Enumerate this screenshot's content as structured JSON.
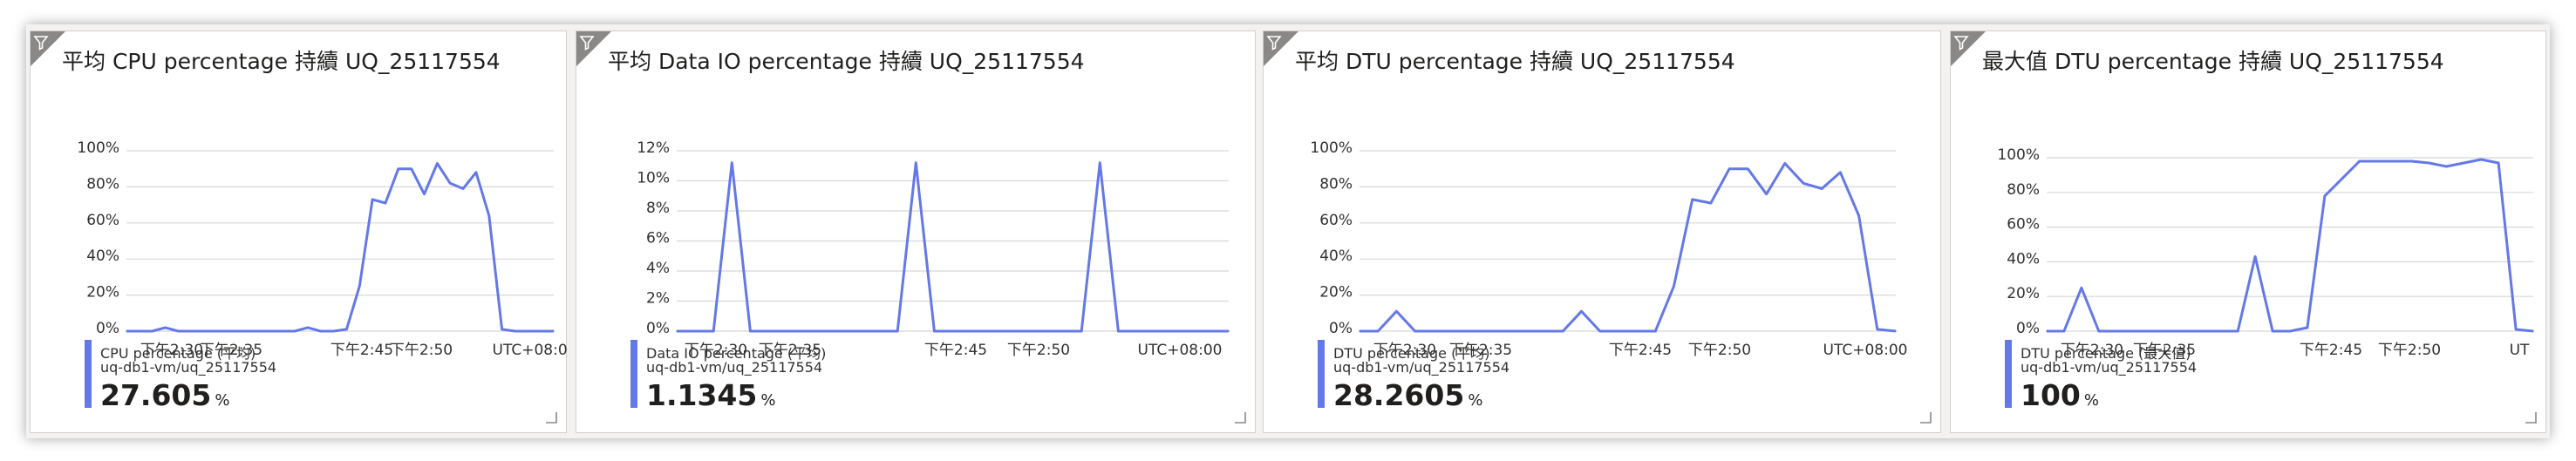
{
  "dashboard": {
    "tiles": [
      {
        "title": "平均 CPU percentage 持續 UQ_25117554",
        "metric_name": "CPU percentage (平均)",
        "resource": "uq-db1-vm/uq_25117554",
        "value": "27.605",
        "unit": "%"
      },
      {
        "title": "平均 Data IO percentage 持續 UQ_25117554",
        "metric_name": "Data IO percentage (平均)",
        "resource": "uq-db1-vm/uq_25117554",
        "value": "1.1345",
        "unit": "%"
      },
      {
        "title": "平均 DTU percentage 持續 UQ_25117554",
        "metric_name": "DTU percentage (平均)",
        "resource": "uq-db1-vm/uq_25117554",
        "value": "28.2605",
        "unit": "%"
      },
      {
        "title": "最大值 DTU percentage 持續 UQ_25117554",
        "metric_name": "DTU percentage (最大值)",
        "resource": "uq-db1-vm/uq_25117554",
        "value": "100",
        "unit": "%"
      }
    ]
  },
  "colors": {
    "line": "#6478e8",
    "grid": "#d7d7d7",
    "axis_text": "#323130",
    "accent": "#6478e8"
  },
  "icons": {
    "filter": "filter-icon",
    "resize": "resize-handle-icon"
  },
  "chart_data": [
    {
      "type": "line",
      "title": "平均 CPU percentage 持續 UQ_25117554",
      "xlabel": "",
      "ylabel": "",
      "ylim": [
        0,
        100
      ],
      "yticks": [
        "0%",
        "20%",
        "40%",
        "60%",
        "80%",
        "100%"
      ],
      "xticks": [
        "下午2:30",
        "下午2:35",
        "下午2:45",
        "下午2:50"
      ],
      "timezone_label": "UTC+08:00",
      "series": [
        {
          "name": "CPU percentage (平均)",
          "x": [
            "14:24",
            "14:25",
            "14:26",
            "14:27",
            "14:28",
            "14:29",
            "14:30",
            "14:31",
            "14:32",
            "14:33",
            "14:34",
            "14:35",
            "14:36",
            "14:37",
            "14:38",
            "14:39",
            "14:40",
            "14:41",
            "14:42",
            "14:43",
            "14:44",
            "14:45",
            "14:46",
            "14:47",
            "14:48",
            "14:49",
            "14:50",
            "14:51",
            "14:52",
            "14:53",
            "14:54",
            "14:55",
            "14:56",
            "14:57"
          ],
          "values": [
            0,
            0,
            0,
            2,
            0,
            0,
            0,
            0,
            0,
            0,
            0,
            0,
            0,
            0,
            2,
            0,
            0,
            1,
            25,
            73,
            71,
            90,
            90,
            76,
            93,
            82,
            79,
            88,
            64,
            1,
            0,
            0,
            0,
            0
          ]
        }
      ]
    },
    {
      "type": "line",
      "title": "平均 Data IO percentage 持續 UQ_25117554",
      "xlabel": "",
      "ylabel": "",
      "ylim": [
        0,
        12
      ],
      "yticks": [
        "0%",
        "2%",
        "4%",
        "6%",
        "8%",
        "10%",
        "12%"
      ],
      "xticks": [
        "下午2:30",
        "下午2:35",
        "下午2:45",
        "下午2:50"
      ],
      "timezone_label": "UTC+08:00",
      "series": [
        {
          "name": "Data IO percentage (平均)",
          "x": [
            "14:27",
            "14:28",
            "14:29",
            "14:30",
            "14:31",
            "14:32",
            "14:33",
            "14:34",
            "14:35",
            "14:36",
            "14:37",
            "14:38",
            "14:39",
            "14:40",
            "14:41",
            "14:42",
            "14:43",
            "14:44",
            "14:45",
            "14:46",
            "14:47",
            "14:48",
            "14:49",
            "14:50",
            "14:51",
            "14:52",
            "14:53",
            "14:54",
            "14:55",
            "14:56",
            "14:57"
          ],
          "values": [
            0,
            0,
            0,
            11.2,
            0,
            0,
            0,
            0,
            0,
            0,
            0,
            0,
            0,
            11.2,
            0,
            0,
            0,
            0,
            0,
            0,
            0,
            0,
            0,
            11.2,
            0,
            0,
            0,
            0,
            0,
            0,
            0
          ]
        }
      ]
    },
    {
      "type": "line",
      "title": "平均 DTU percentage 持續 UQ_25117554",
      "xlabel": "",
      "ylabel": "",
      "ylim": [
        0,
        100
      ],
      "yticks": [
        "0%",
        "20%",
        "40%",
        "60%",
        "80%",
        "100%"
      ],
      "xticks": [
        "下午2:30",
        "下午2:35",
        "下午2:45",
        "下午2:50"
      ],
      "timezone_label": "UTC+08:00",
      "series": [
        {
          "name": "DTU percentage (平均)",
          "x": [
            "14:27",
            "14:28",
            "14:29",
            "14:30",
            "14:31",
            "14:32",
            "14:33",
            "14:34",
            "14:35",
            "14:36",
            "14:37",
            "14:38",
            "14:39",
            "14:40",
            "14:41",
            "14:42",
            "14:43",
            "14:44",
            "14:45",
            "14:46",
            "14:47",
            "14:48",
            "14:49",
            "14:50",
            "14:51",
            "14:52",
            "14:53",
            "14:54",
            "14:55",
            "14:56"
          ],
          "values": [
            0,
            0,
            11,
            0,
            0,
            0,
            0,
            0,
            0,
            0,
            0,
            0,
            11,
            0,
            0,
            0,
            0,
            25,
            73,
            71,
            90,
            90,
            76,
            93,
            82,
            79,
            88,
            64,
            1,
            0
          ]
        }
      ]
    },
    {
      "type": "line",
      "title": "最大值 DTU percentage 持續 UQ_25117554",
      "xlabel": "",
      "ylabel": "",
      "ylim": [
        0,
        100
      ],
      "yticks": [
        "0%",
        "20%",
        "40%",
        "60%",
        "80%",
        "100%"
      ],
      "xticks": [
        "下午2:30",
        "下午2:35",
        "下午2:45",
        "下午2:50"
      ],
      "timezone_label": "UT",
      "series": [
        {
          "name": "DTU percentage (最大值)",
          "x": [
            "14:28",
            "14:29",
            "14:30",
            "14:31",
            "14:32",
            "14:33",
            "14:34",
            "14:35",
            "14:36",
            "14:37",
            "14:38",
            "14:39",
            "14:40",
            "14:41",
            "14:42",
            "14:43",
            "14:44",
            "14:45",
            "14:46",
            "14:47",
            "14:48",
            "14:49",
            "14:50",
            "14:51",
            "14:52",
            "14:53",
            "14:54",
            "14:55",
            "14:56"
          ],
          "values": [
            0,
            0,
            25,
            0,
            0,
            0,
            0,
            0,
            0,
            0,
            0,
            0,
            43,
            0,
            0,
            2,
            78,
            88,
            98,
            98,
            98,
            98,
            97,
            95,
            97,
            99,
            97,
            1,
            0
          ]
        }
      ]
    }
  ]
}
